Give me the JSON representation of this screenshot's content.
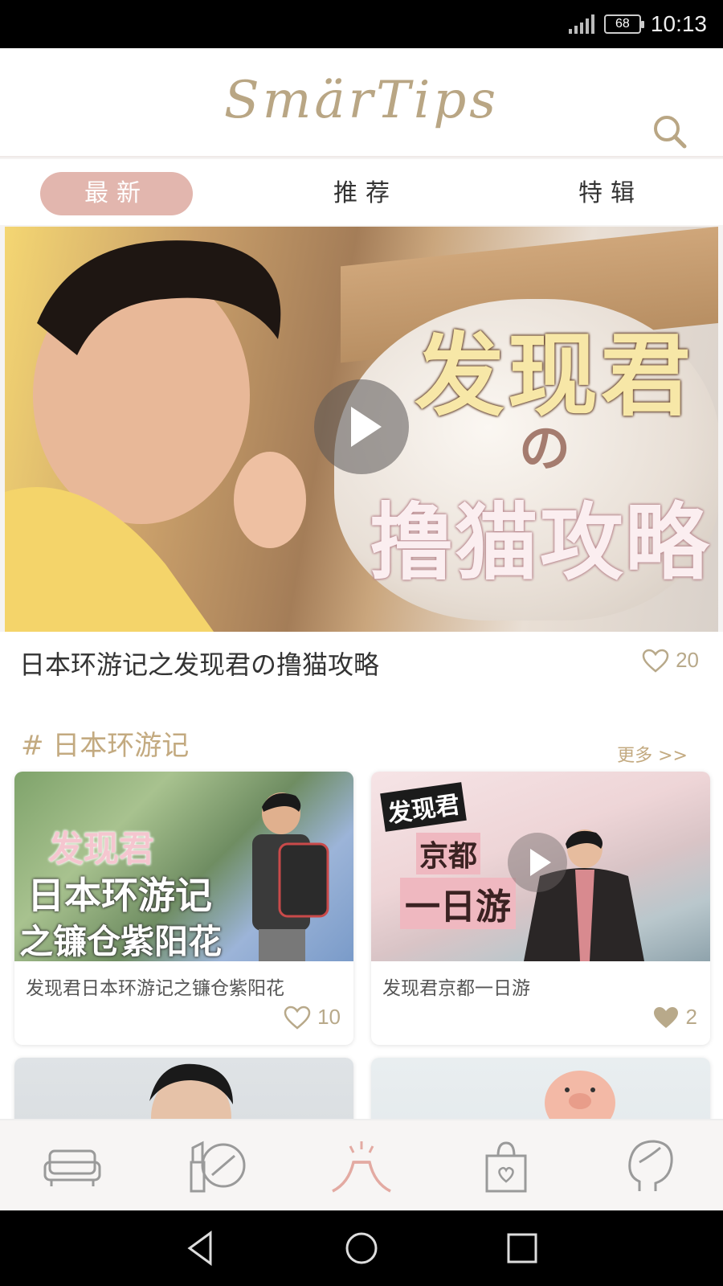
{
  "status_bar": {
    "battery": "68",
    "time": "10:13"
  },
  "header": {
    "logo": "SmärTips",
    "search_icon": "search-icon"
  },
  "tabs": [
    {
      "label": "最新",
      "active": true
    },
    {
      "label": "推荐",
      "active": false
    },
    {
      "label": "特辑",
      "active": false
    }
  ],
  "hero": {
    "image_text": [
      "发现君",
      "の",
      "撸猫攻略"
    ],
    "caption": "日本环游记之发现君の撸猫攻略",
    "likes": "20"
  },
  "section": {
    "title": "# 日本环游记",
    "more": "更多 >>",
    "cards": [
      {
        "thumb_text": [
          "发现君",
          "日本环游记",
          "之镰仓紫阳花"
        ],
        "title": "发现君日本环游记之镰仓紫阳花",
        "likes": "10",
        "liked": false
      },
      {
        "thumb_text": [
          "发现君",
          "京都",
          "一日游"
        ],
        "title": "发现君京都一日游",
        "likes": "2",
        "liked": true
      }
    ]
  },
  "bottom_nav": [
    {
      "name": "sofa-icon"
    },
    {
      "name": "makeup-icon"
    },
    {
      "name": "travel-icon",
      "active": true
    },
    {
      "name": "shopping-bag-icon"
    },
    {
      "name": "profile-head-icon"
    }
  ],
  "colors": {
    "accent": "#e2b6ae",
    "gold": "#c3aa80",
    "active_nav": "#e3aaa2"
  }
}
